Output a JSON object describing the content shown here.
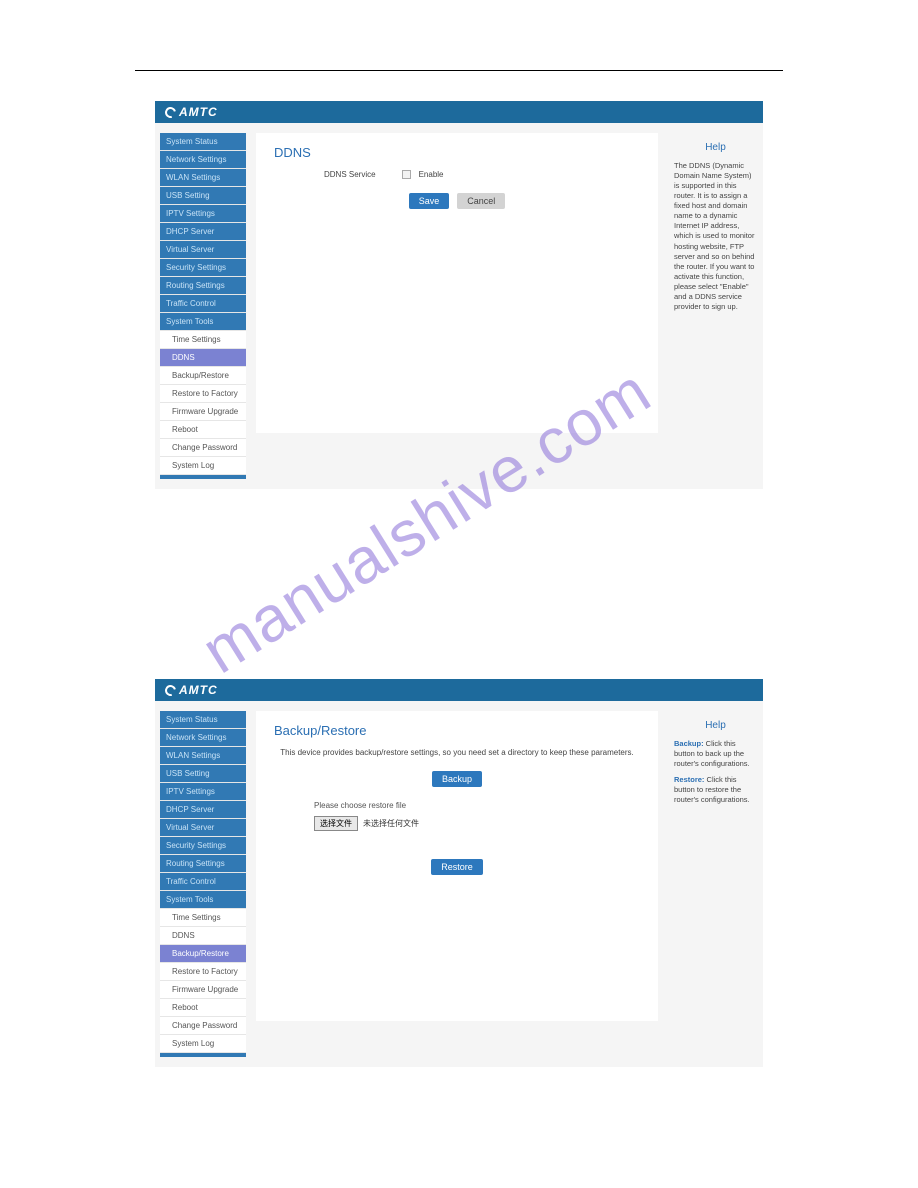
{
  "watermark": "manualshive.com",
  "logo": "AMTC",
  "shot1": {
    "title": "DDNS",
    "field_label": "DDNS Service",
    "enable_label": "Enable",
    "save": "Save",
    "cancel": "Cancel",
    "sidebar_top": [
      "System Status",
      "Network Settings",
      "WLAN Settings",
      "USB Setting",
      "IPTV Settings",
      "DHCP Server",
      "Virtual Server",
      "Security Settings",
      "Routing Settings",
      "Traffic Control",
      "System Tools"
    ],
    "sidebar_sub": [
      "Time Settings",
      "DDNS",
      "Backup/Restore",
      "Restore to Factory",
      "Firmware Upgrade",
      "Reboot",
      "Change Password",
      "System Log"
    ],
    "sidebar_active": "DDNS",
    "help": {
      "title": "Help",
      "text": "The DDNS (Dynamic Domain Name System) is supported in this router. It is to assign a fixed host and domain name to a dynamic Internet IP address, which is used to monitor hosting website, FTP server and so on behind the router. If you want to activate this function, please select \"Enable\" and a DDNS service provider to sign up."
    }
  },
  "shot2": {
    "title": "Backup/Restore",
    "desc": "This device provides backup/restore settings, so you need set a directory to keep these parameters.",
    "backup": "Backup",
    "choose_note": "Please choose restore file",
    "file_btn": "选择文件",
    "file_none": "未选择任何文件",
    "restore": "Restore",
    "sidebar_top": [
      "System Status",
      "Network Settings",
      "WLAN Settings",
      "USB Setting",
      "IPTV Settings",
      "DHCP Server",
      "Virtual Server",
      "Security Settings",
      "Routing Settings",
      "Traffic Control",
      "System Tools"
    ],
    "sidebar_sub": [
      "Time Settings",
      "DDNS",
      "Backup/Restore",
      "Restore to Factory",
      "Firmware Upgrade",
      "Reboot",
      "Change Password",
      "System Log"
    ],
    "sidebar_active": "Backup/Restore",
    "help": {
      "title": "Help",
      "backup_term": "Backup:",
      "backup_text": " Click this button to back up the router's configurations.",
      "restore_term": "Restore:",
      "restore_text": " Click this button to restore the router's configurations."
    }
  }
}
